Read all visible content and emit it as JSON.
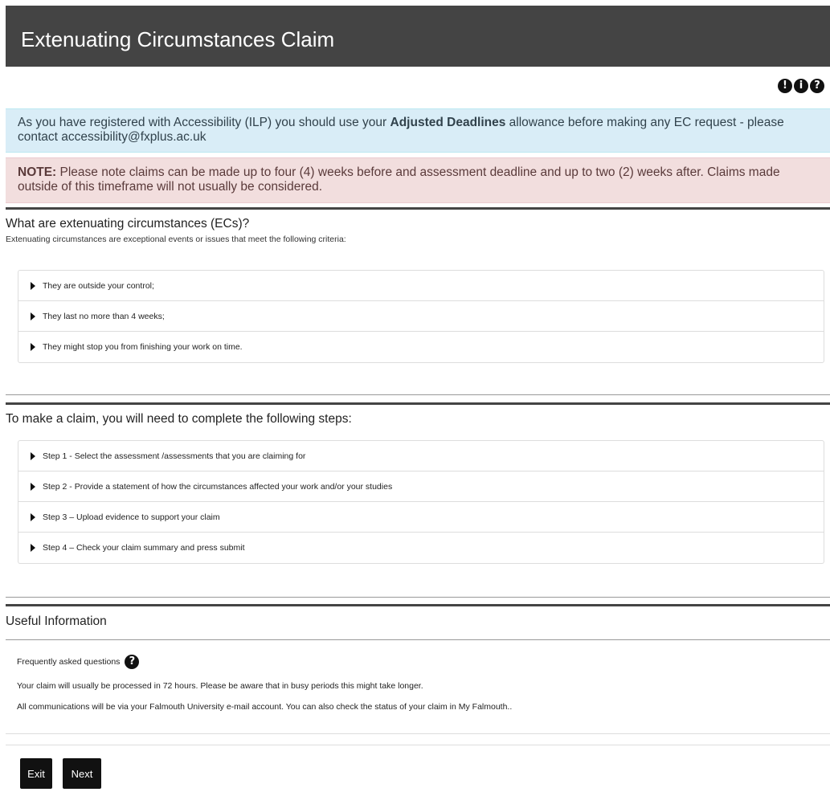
{
  "header": {
    "title": "Extenuating Circumstances Claim"
  },
  "help_icons": [
    {
      "name": "exclamation-icon",
      "glyph": "!"
    },
    {
      "name": "info-icon",
      "glyph": "i"
    },
    {
      "name": "question-icon",
      "glyph": "?"
    }
  ],
  "alerts": {
    "info": {
      "prefix": "As you have registered with Accessibility (ILP) you should use your ",
      "bold": "Adjusted Deadlines",
      "suffix": " allowance before making any EC request - please contact accessibility@fxplus.ac.uk"
    },
    "note": {
      "label": "NOTE:",
      "text": " Please note claims can be made up to four (4) weeks before and assessment deadline and up to two (2) weeks after. Claims made outside of this timeframe will not usually be considered."
    }
  },
  "ec_section": {
    "title": "What are extenuating circumstances (ECs)?",
    "subtitle": "Extenuating circumstances are exceptional events or issues that meet the following criteria:",
    "criteria": [
      "They are outside your control;",
      "They last no more than 4 weeks;",
      "They might stop you from finishing your work on time."
    ]
  },
  "steps_section": {
    "title": "To make a claim, you will need to complete the following steps:",
    "steps": [
      "Step 1 - Select the assessment /assessments that you are claiming for",
      "Step 2 - Provide a statement of how the circumstances affected your work and/or your studies",
      "Step 3 – Upload evidence to support your claim",
      "Step 4 – Check your claim summary and press submit"
    ]
  },
  "useful_section": {
    "title": "Useful Information",
    "faq_label": "Frequently asked questions",
    "faq_icon": "?",
    "line1": "Your claim will usually be processed in 72 hours. Please be aware that in busy periods this might take longer.",
    "line2": "All communications will be via your Falmouth University e-mail account. You can also check the status of your claim in My Falmouth.."
  },
  "buttons": {
    "exit": "Exit",
    "next": "Next"
  }
}
